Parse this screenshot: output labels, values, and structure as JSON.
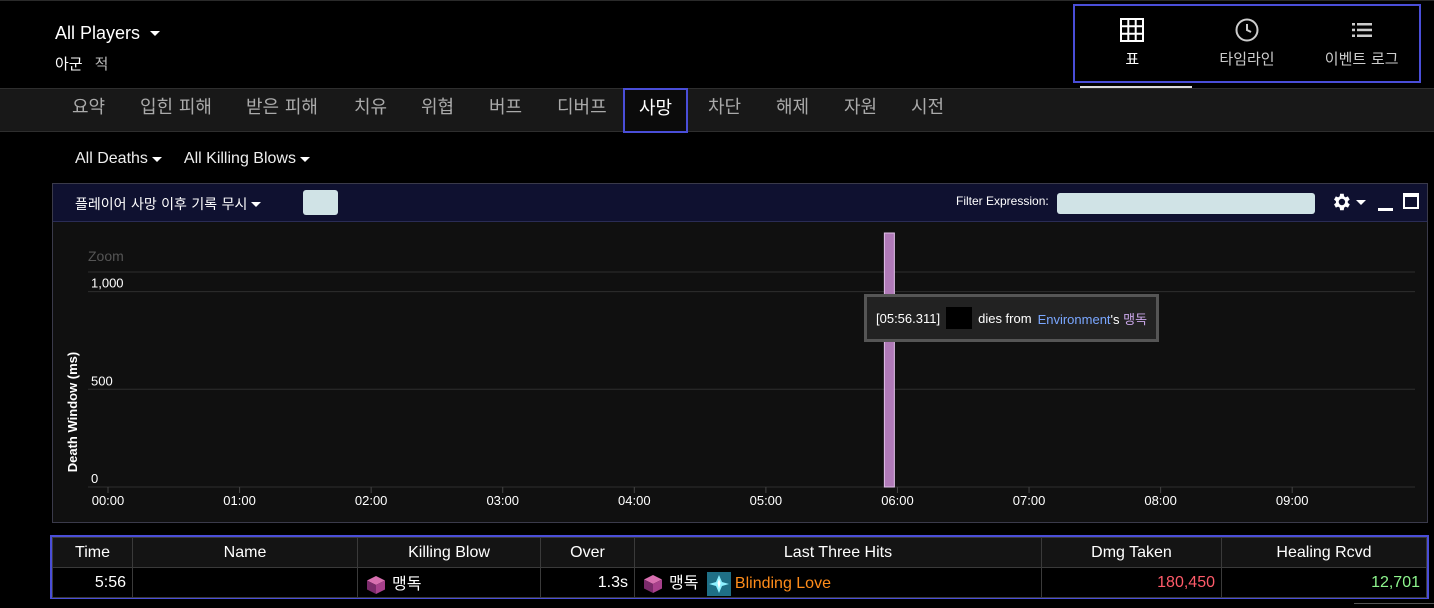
{
  "header": {
    "player_select": "All Players",
    "factions": [
      "아군",
      "적"
    ]
  },
  "view_switch": [
    {
      "label": "표",
      "icon": "grid-icon",
      "active": true
    },
    {
      "label": "타임라인",
      "icon": "clock-icon",
      "active": false
    },
    {
      "label": "이벤트 로그",
      "icon": "list-icon",
      "active": false
    }
  ],
  "tabs": [
    "요약",
    "입힌 피해",
    "받은 피해",
    "치유",
    "위협",
    "버프",
    "디버프",
    "사망",
    "차단",
    "해제",
    "자원",
    "시전"
  ],
  "active_tab": "사망",
  "filters": {
    "deaths": "All Deaths",
    "killing_blows": "All Killing Blows"
  },
  "panel": {
    "ignore_after_death": "플레이어 사망 이후 기록 무시",
    "filter_label": "Filter Expression:",
    "filter_value": ""
  },
  "chart_data": {
    "type": "bar",
    "zoom_label": "Zoom",
    "ylabel": "Death Window (ms)",
    "xlabel": "",
    "ylim": [
      0,
      1300
    ],
    "y_ticks": [
      0,
      500,
      1000
    ],
    "y_tick_labels": [
      "0",
      "500",
      "1,000"
    ],
    "x_tick_labels": [
      "00:00",
      "01:00",
      "02:00",
      "03:00",
      "04:00",
      "05:00",
      "06:00",
      "07:00",
      "08:00",
      "09:00"
    ],
    "x_range_seconds": [
      0,
      596
    ],
    "points": [
      {
        "x_label": "05:56.311",
        "x_seconds": 356.311,
        "value": 1300
      }
    ],
    "grid": true,
    "colors": {
      "bar": "#b07ab8"
    }
  },
  "tooltip": {
    "time": "[05:56.311]",
    "text_dies_from": "dies from",
    "source": "Environment",
    "possessive": "'s",
    "ability": "맹독"
  },
  "table": {
    "columns": [
      "Time",
      "Name",
      "Killing Blow",
      "Over",
      "Last Three Hits",
      "Dmg Taken",
      "Healing Rcvd"
    ],
    "rows": [
      {
        "time": "5:56",
        "name": "",
        "killing_blow": "맹독",
        "over": "1.3s",
        "last_hits": [
          {
            "name": "맹독",
            "icon": "poison-cube-icon",
            "quality": "normal"
          },
          {
            "name": "Blinding Love",
            "icon": "wing-icon",
            "quality": "legendary"
          }
        ],
        "dmg_taken": "180,450",
        "healing_rcvd": "12,701"
      }
    ]
  },
  "colors": {
    "accent": "#4a4ed8",
    "damage": "#ff5b6a",
    "healing": "#8df58d",
    "legendary": "#ff8c1a",
    "link": "#7aa7ff"
  }
}
